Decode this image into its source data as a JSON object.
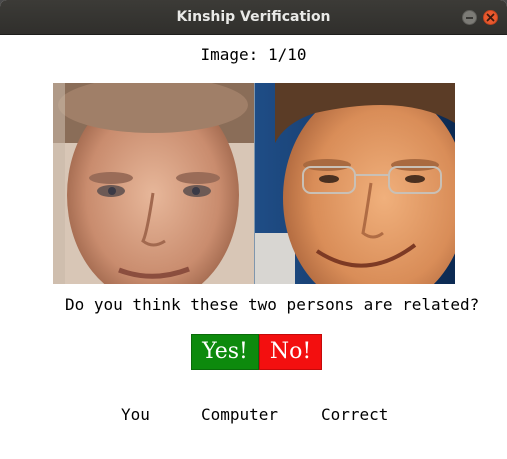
{
  "window": {
    "title": "Kinship Verification",
    "controls": [
      "minimize-icon",
      "close-icon"
    ]
  },
  "counter": "Image: 1/10",
  "images": [
    {
      "name": "left-face"
    },
    {
      "name": "right-face"
    }
  ],
  "question": "Do you think these two persons are related?",
  "buttons": {
    "yes": "Yes!",
    "no": "No!"
  },
  "score_labels": {
    "you": "You",
    "computer": "Computer",
    "correct": "Correct"
  },
  "colors": {
    "yes_button": "#0d8a0d",
    "no_button": "#f30f0f"
  }
}
